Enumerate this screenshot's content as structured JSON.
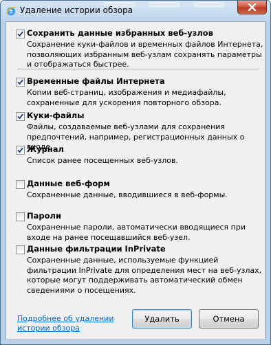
{
  "window": {
    "title": "Удаление истории обзора"
  },
  "options": [
    {
      "label": "Сохранить данные избранных веб-узлов",
      "description": "Сохранение куки-файлов и временных файлов Интернета, позволяющих избранным веб-узлам сохранять параметры и отображаться быстрее.",
      "checked": true
    },
    {
      "label": "Временные файлы Интернета",
      "description": "Копии веб-страниц, изображения и медиафайлы, сохраненные для ускорения повторного обзора.",
      "checked": true
    },
    {
      "label": "Куки-файлы",
      "description": "Файлы, создаваемые веб-узлами для сохранения предпочтений, например, регистрационных данных о входе.",
      "checked": true
    },
    {
      "label": "Журнал",
      "description": "Список ранее посещенных веб-узлов.",
      "checked": true
    },
    {
      "label": "Данные веб-форм",
      "description": "Сохраненные данные, вводившиеся в веб-формы.",
      "checked": false
    },
    {
      "label": "Пароли",
      "description": "Сохраненные пароли, автоматически вводящиеся при входе на ранее посещавшийся веб-узел.",
      "checked": false
    },
    {
      "label": "Данные фильтрации InPrivate",
      "description": "Сохраненные данные, используемые функцией фильтрации InPrivate для определения мест на веб-узлах, которые могут поддерживать автоматический обмен сведениями о посещениях.",
      "checked": false
    }
  ],
  "footer": {
    "more_link": "Подробнее об удалении истории обзора",
    "delete_button": "Удалить",
    "cancel_button": "Отмена"
  }
}
